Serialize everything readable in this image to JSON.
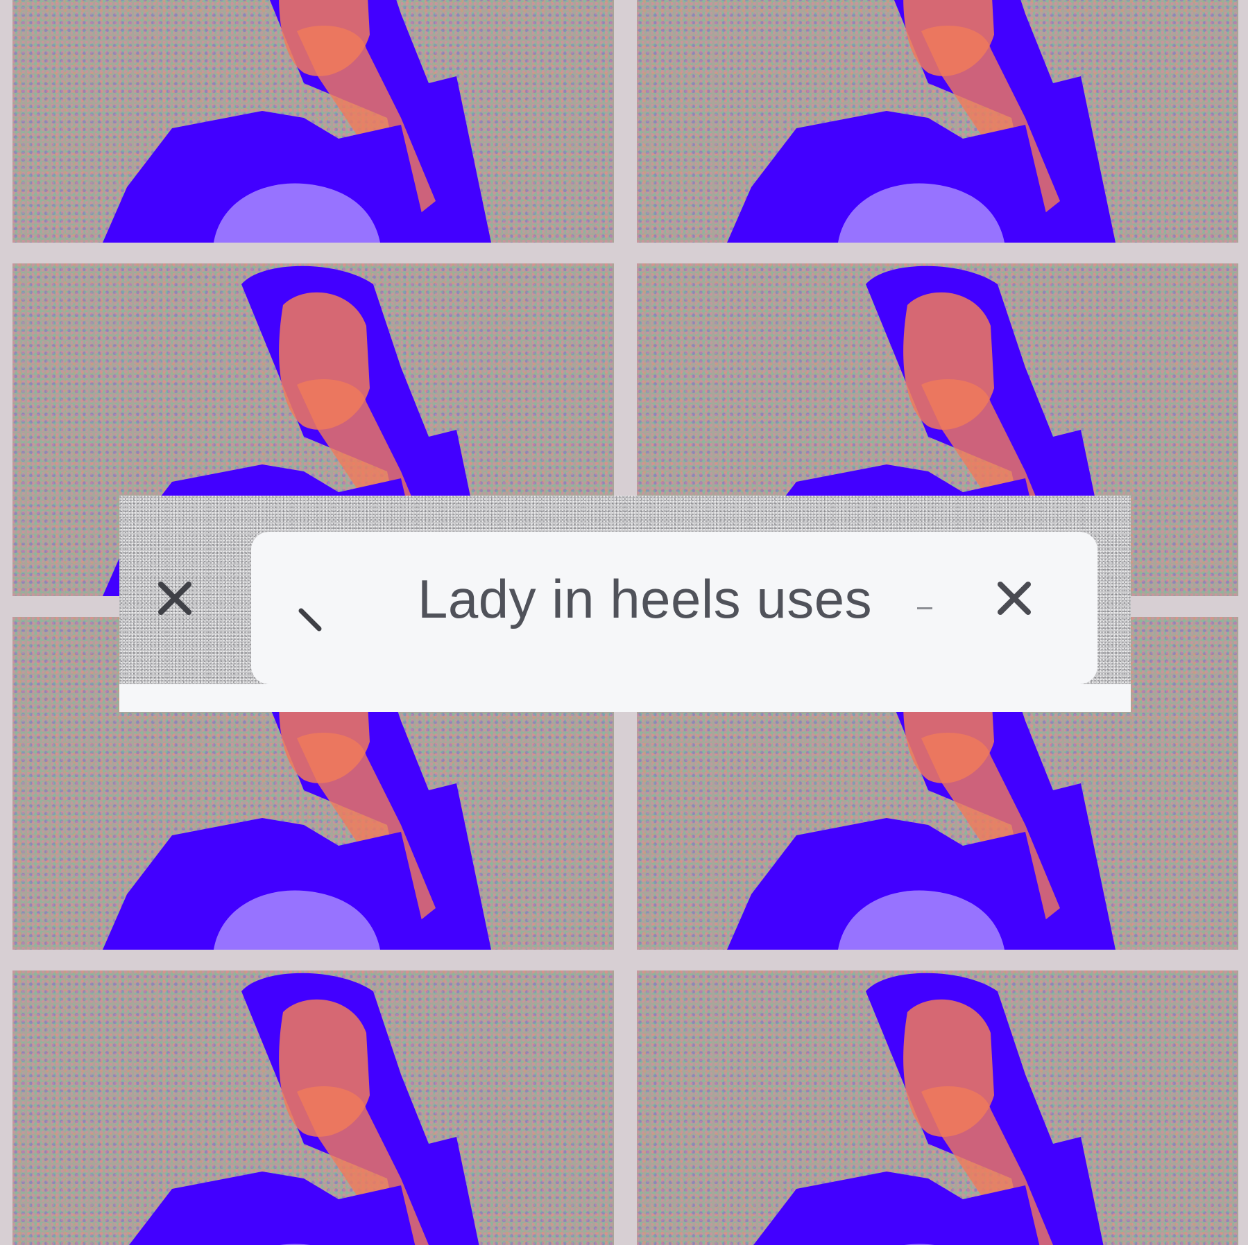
{
  "background": {
    "gutter_color": "#d7cfd3",
    "tile_count": 8,
    "tile_subject": "repeated-photo",
    "colors": {
      "noise": "#a9a69a",
      "figure": "#4200ff",
      "skin": "#f07a5a"
    }
  },
  "search_bar": {
    "query": "Lady in heels uses",
    "left_icon": "close-icon",
    "right_icon": "close-icon",
    "search_icon": "search-icon",
    "text_color": "#50525a",
    "field_color": "#f6f7f9"
  }
}
